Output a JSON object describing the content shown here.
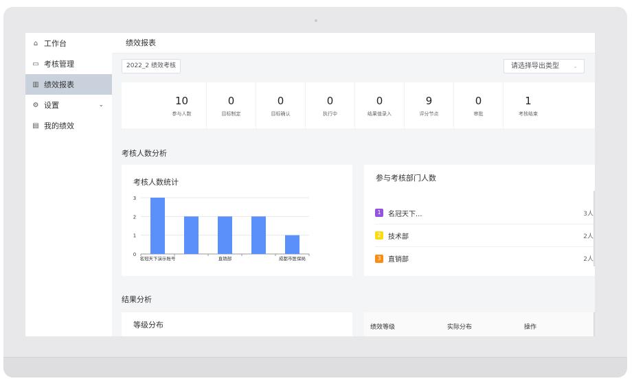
{
  "sidebar": {
    "items": [
      {
        "icon": "home-icon",
        "glyph": "⌂",
        "label": "工作台"
      },
      {
        "icon": "assessment-icon",
        "glyph": "▭",
        "label": "考核管理"
      },
      {
        "icon": "chart-icon",
        "glyph": "▥",
        "label": "绩效报表"
      },
      {
        "icon": "gear-icon",
        "glyph": "⚙",
        "label": "设置"
      },
      {
        "icon": "performance-icon",
        "glyph": "▤",
        "label": "我的绩效"
      }
    ],
    "chevron": "⌄"
  },
  "header": {
    "title": "绩效报表"
  },
  "filter": {
    "cycle_label": "2022_2 绩效考核"
  },
  "export": {
    "placeholder": "请选择导出类型",
    "arrow": "⌄"
  },
  "stats": [
    {
      "value": "10",
      "label": "参与人数"
    },
    {
      "value": "0",
      "label": "目标制定"
    },
    {
      "value": "0",
      "label": "目标确认"
    },
    {
      "value": "0",
      "label": "执行中"
    },
    {
      "value": "0",
      "label": "结果值录入"
    },
    {
      "value": "9",
      "label": "评分节点"
    },
    {
      "value": "0",
      "label": "审批"
    },
    {
      "value": "1",
      "label": "考核结束"
    }
  ],
  "analysis": {
    "section_title": "考核人数分析",
    "chart_card_title": "考核人数统计",
    "dept_card_title": "参与考核部门人数"
  },
  "chart_data": {
    "type": "bar",
    "categories": [
      "名冠天下演示账号",
      "",
      "直销部",
      "",
      "成都市医保局"
    ],
    "values": [
      3,
      2,
      2,
      2,
      1
    ],
    "ylim": [
      0,
      3
    ],
    "yticks": [
      "0",
      "1",
      "2",
      "3"
    ],
    "color": "#5b8ff9"
  },
  "departments": [
    {
      "rank": "1",
      "name": "名冠天下...",
      "count": "3人",
      "color": "#9254de"
    },
    {
      "rank": "2",
      "name": "技术部",
      "count": "2人",
      "color": "#fadb14"
    },
    {
      "rank": "3",
      "name": "直销部",
      "count": "2人",
      "color": "#fa8c16"
    }
  ],
  "results": {
    "section_title": "结果分析",
    "grade_card_title": "等级分布",
    "table_headers": [
      "绩效等级",
      "实际分布",
      "操作"
    ]
  }
}
